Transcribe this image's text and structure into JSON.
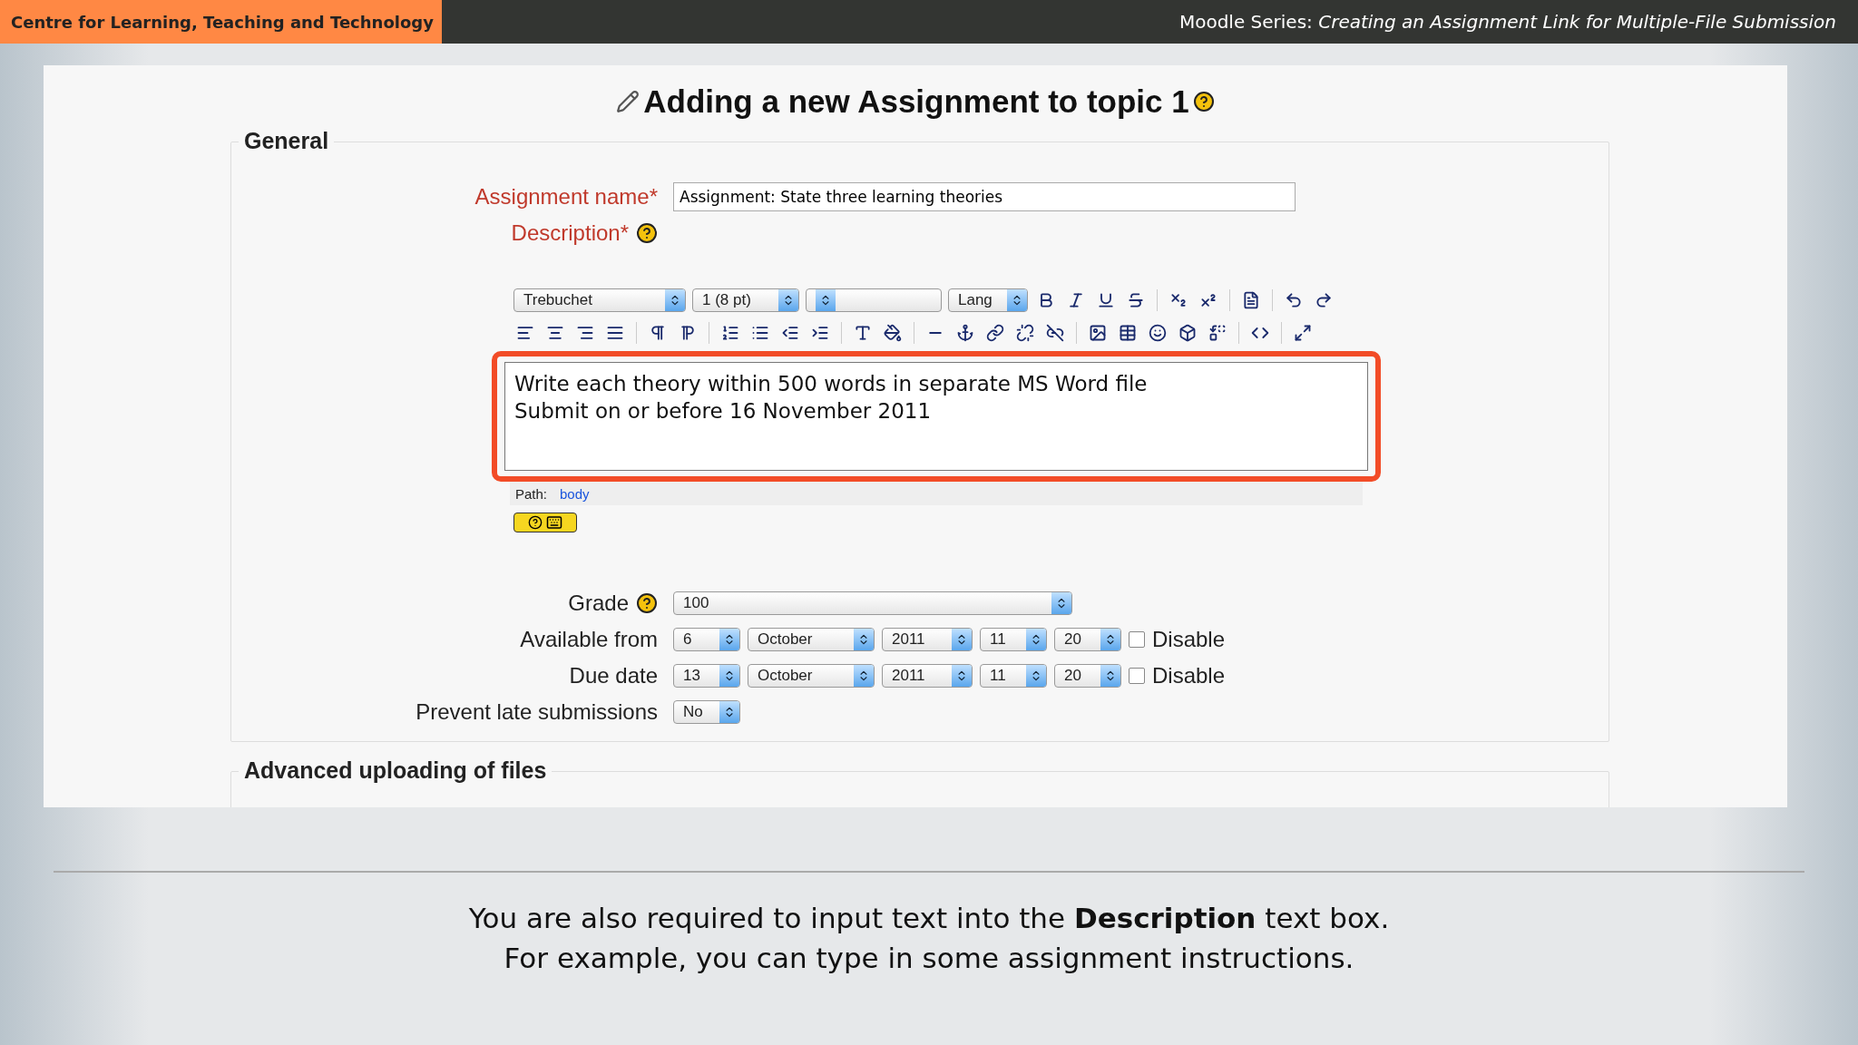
{
  "header": {
    "org": "Centre for Learning, Teaching and Technology",
    "series": "Moodle Series: *Creating an Assignment Link for Multiple-File Submission*"
  },
  "form": {
    "title": "Adding a new Assignment to topic 1",
    "general": {
      "legend": "General",
      "name": {
        "label": "Assignment name*",
        "value": "Assignment: State three learning theories"
      },
      "description": {
        "label": "Description*"
      },
      "editor": {
        "toolbar_rows": [
          [
            {
              "kind": "select",
              "value": "Trebuchet"
            },
            {
              "kind": "select",
              "value": "1 (8 pt)"
            },
            {
              "kind": "select"
            },
            {
              "kind": "select",
              "value": "Lang"
            },
            {
              "kind": "bold"
            },
            {
              "kind": "italic"
            },
            {
              "kind": "underline"
            },
            {
              "kind": "strike"
            },
            {
              "kind": "sep"
            },
            {
              "kind": "subscript"
            },
            {
              "kind": "superscript"
            },
            {
              "kind": "sep"
            },
            {
              "kind": "paste"
            },
            {
              "kind": "sep"
            },
            {
              "kind": "undo"
            },
            {
              "kind": "redo"
            }
          ],
          [
            {
              "kind": "align-left"
            },
            {
              "kind": "align-center"
            },
            {
              "kind": "align-right"
            },
            {
              "kind": "justify"
            },
            {
              "kind": "sep"
            },
            {
              "kind": "ltr"
            },
            {
              "kind": "rtl"
            },
            {
              "kind": "sep"
            },
            {
              "kind": "ordered-list"
            },
            {
              "kind": "unordered-list"
            },
            {
              "kind": "outdent"
            },
            {
              "kind": "indent"
            },
            {
              "kind": "sep"
            },
            {
              "kind": "text-color"
            },
            {
              "kind": "fill-color"
            },
            {
              "kind": "sep"
            },
            {
              "kind": "rule"
            },
            {
              "kind": "anchor"
            },
            {
              "kind": "link"
            },
            {
              "kind": "unlink"
            },
            {
              "kind": "nolink"
            },
            {
              "kind": "sep"
            },
            {
              "kind": "image"
            },
            {
              "kind": "table"
            },
            {
              "kind": "smiley"
            },
            {
              "kind": "box"
            },
            {
              "kind": "replace"
            },
            {
              "kind": "sep"
            },
            {
              "kind": "code"
            },
            {
              "kind": "sep"
            },
            {
              "kind": "fullscreen"
            }
          ]
        ],
        "lines": [
          "Write each theory within 500 words in separate MS Word file",
          "Submit on or before 16 November 2011"
        ],
        "highlighted": true,
        "path_label": "Path:",
        "path_link": "body"
      },
      "rows": [
        {
          "kind": "grade",
          "label": "Grade",
          "help": true,
          "selects": [
            {
              "value": "100"
            }
          ]
        },
        {
          "kind": "date",
          "label": "Available from",
          "selects": [
            {
              "value": "6"
            },
            {
              "value": "October"
            },
            {
              "value": "2011"
            },
            {
              "value": "11"
            },
            {
              "value": "20"
            }
          ],
          "disable": {
            "label": "Disable",
            "checked": false
          }
        },
        {
          "kind": "date",
          "label": "Due date",
          "selects": [
            {
              "value": "13"
            },
            {
              "value": "October"
            },
            {
              "value": "2011"
            },
            {
              "value": "11"
            },
            {
              "value": "20"
            }
          ],
          "disable": {
            "label": "Disable",
            "checked": false
          }
        },
        {
          "kind": "select",
          "label": "Prevent late submissions",
          "selects": [
            {
              "value": "No"
            }
          ]
        }
      ]
    },
    "advanced": {
      "legend": "Advanced uploading of files"
    }
  },
  "caption": [
    "You are also required to input text into the **Description** text box.",
    "For example, you can type in some assignment instructions."
  ]
}
